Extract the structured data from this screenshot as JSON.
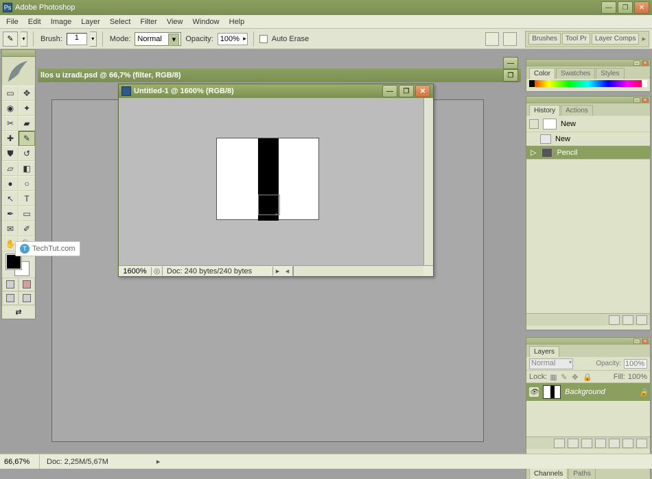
{
  "title": "Adobe Photoshop",
  "menu": [
    "File",
    "Edit",
    "Image",
    "Layer",
    "Select",
    "Filter",
    "View",
    "Window",
    "Help"
  ],
  "options": {
    "brush_label": "Brush:",
    "brush_size": "1",
    "mode_label": "Mode:",
    "mode_value": "Normal",
    "opacity_label": "Opacity:",
    "opacity_value": "100%",
    "autoerase_label": "Auto Erase",
    "dock_tabs": [
      "Brushes",
      "Tool Pr",
      "Layer Comps"
    ]
  },
  "doc1": {
    "title": "llos u izradi.psd @ 66,7% (filter, RGB/8)"
  },
  "doc2": {
    "title": "Untitled-1 @ 1600% (RGB/8)",
    "zoom": "1600%",
    "info": "Doc: 240 bytes/240 bytes"
  },
  "status": {
    "zoom": "66,67%",
    "doc": "Doc: 2,25M/5,67M"
  },
  "panels": {
    "color_tabs": [
      "Color",
      "Swatches",
      "Styles"
    ],
    "history_tabs": [
      "History",
      "Actions"
    ],
    "history_state": "New",
    "history_steps": [
      "New",
      "Pencil"
    ],
    "layers_tabs": [
      "Layers"
    ],
    "layers": {
      "blend": "Normal",
      "opacity_lbl": "Opacity:",
      "opacity_val": "100%",
      "lock_lbl": "Lock:",
      "fill_lbl": "Fill:",
      "fill_val": "100%",
      "layer_name": "Background"
    },
    "channels_tabs": [
      "Channels",
      "Paths"
    ]
  },
  "watermark": "TechTut.com"
}
